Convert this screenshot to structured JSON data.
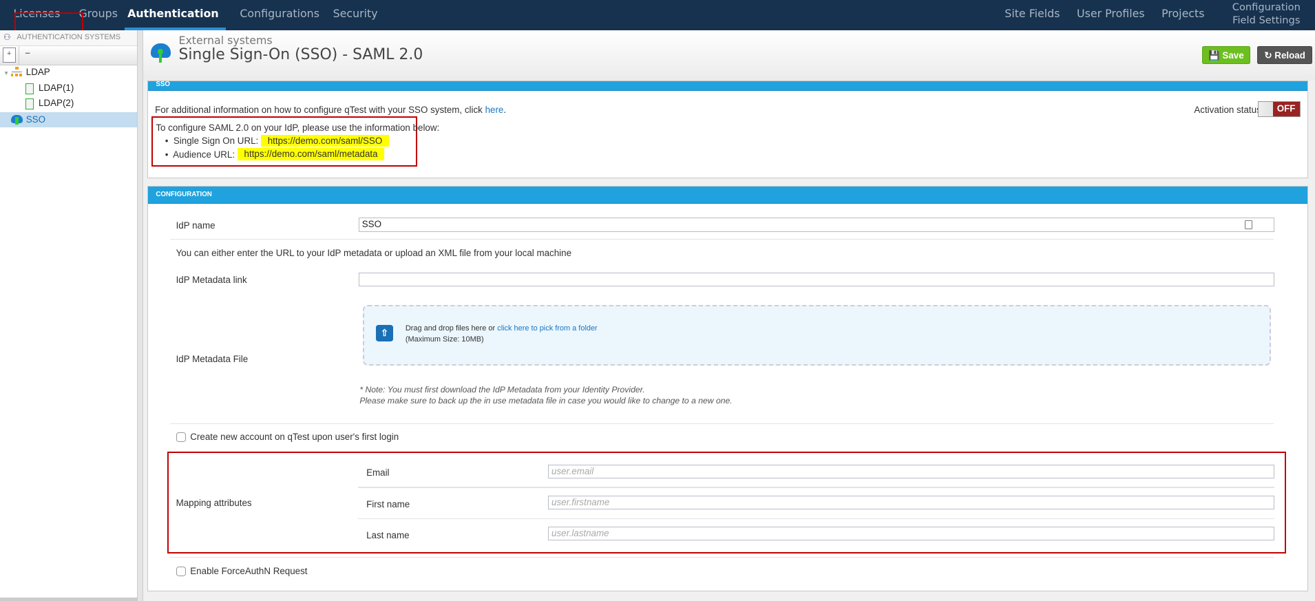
{
  "topnav": {
    "tabs": [
      "Licenses",
      "Groups",
      "Authentication",
      "Configurations",
      "Security"
    ],
    "active": "Authentication",
    "right_tabs": [
      "Site Fields",
      "User Profiles",
      "Projects"
    ],
    "config_field_settings": [
      "Configuration",
      "Field Settings"
    ]
  },
  "sidebar": {
    "header": "AUTHENTICATION SYSTEMS",
    "collapse_label": "–",
    "tree": {
      "ldap": "LDAP",
      "ldap1": "LDAP(1)",
      "ldap2": "LDAP(2)",
      "sso": "SSO"
    }
  },
  "header": {
    "subtitle": "External systems",
    "title": "Single Sign-On (SSO) - SAML 2.0",
    "save": "Save",
    "reload": "Reload"
  },
  "sso": {
    "title": "SSO",
    "info_prefix": "For additional information on how to configure qTest with your SSO system, click ",
    "info_link": "here",
    "info_suffix": ".",
    "configure_text": "To configure SAML 2.0 on your IdP, please use the information below:",
    "sso_url_label": "Single Sign On URL:",
    "sso_url": "https://demo.com/saml/SSO",
    "audience_label": "Audience URL:",
    "audience_url": "https://demo.com/saml/metadata",
    "activation_label": "Activation status",
    "activation_value": "OFF"
  },
  "config": {
    "title": "CONFIGURATION",
    "idp_name_label": "IdP name",
    "idp_name_value": "SSO",
    "either_text": "You can either enter the URL to your IdP metadata or upload an XML file from your local machine",
    "metadata_link_label": "IdP Metadata link",
    "metadata_link_value": "",
    "metadata_file_label": "IdP Metadata File",
    "drop_text": "Drag and drop files here or ",
    "drop_link": "click here to pick from a folder",
    "max_size": "(Maximum Size: 10MB)",
    "note1": "* Note: You must first download the IdP Metadata from your Identity Provider.",
    "note2": "Please make sure to back up the in use metadata file in case you would like to change to a new one.",
    "create_account_label": "Create new account on qTest upon user's first login",
    "mapping_label": "Mapping attributes",
    "mapping": [
      {
        "label": "Email",
        "placeholder": "user.email"
      },
      {
        "label": "First name",
        "placeholder": "user.firstname"
      },
      {
        "label": "Last name",
        "placeholder": "user.lastname"
      }
    ],
    "forceauthn_label": "Enable ForceAuthN Request"
  },
  "colors": {
    "nav": "#17324f",
    "accent": "#1fa2dd",
    "save": "#6cbf1f",
    "off": "#9b2222",
    "annotation": "#c00000",
    "highlight": "#ffff00"
  }
}
